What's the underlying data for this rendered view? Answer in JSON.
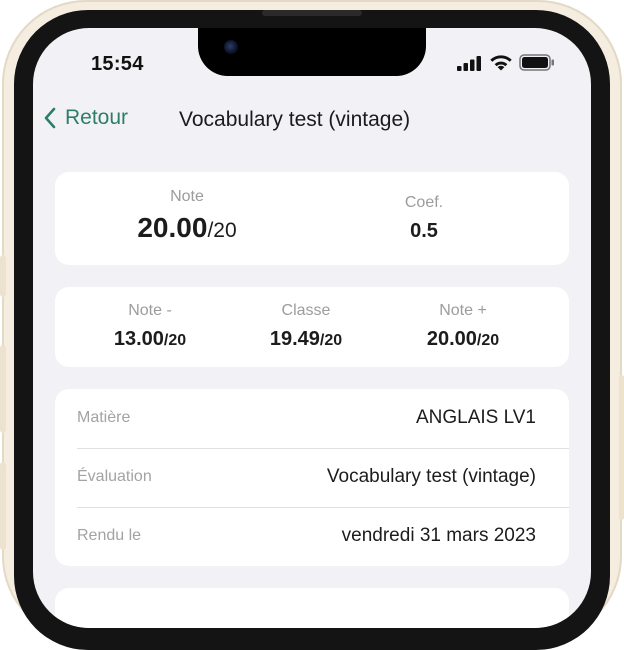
{
  "status_bar": {
    "time": "15:54"
  },
  "nav": {
    "back_label": "Retour",
    "title": "Vocabulary test (vintage)"
  },
  "grade_card": {
    "note_label": "Note",
    "note_value": "20.00",
    "note_out_of": "/20",
    "coef_label": "Coef.",
    "coef_value": "0.5"
  },
  "stats_card": [
    {
      "label": "Note -",
      "value": "13.00",
      "out_of": "/20"
    },
    {
      "label": "Classe",
      "value": "19.49",
      "out_of": "/20"
    },
    {
      "label": "Note +",
      "value": "20.00",
      "out_of": "/20"
    }
  ],
  "details_card": [
    {
      "label": "Matière",
      "value": "ANGLAIS LV1"
    },
    {
      "label": "Évaluation",
      "value": "Vocabulary test (vintage)"
    },
    {
      "label": "Rendu le",
      "value": "vendredi 31 mars 2023"
    }
  ],
  "colors": {
    "accent": "#2e7d6b",
    "background": "#f2f2f6",
    "card": "#ffffff",
    "frame": "#f4ede0"
  },
  "icons": [
    "camera-icon",
    "signal-icon",
    "wifi-icon",
    "battery-icon",
    "chevron-left-icon"
  ]
}
